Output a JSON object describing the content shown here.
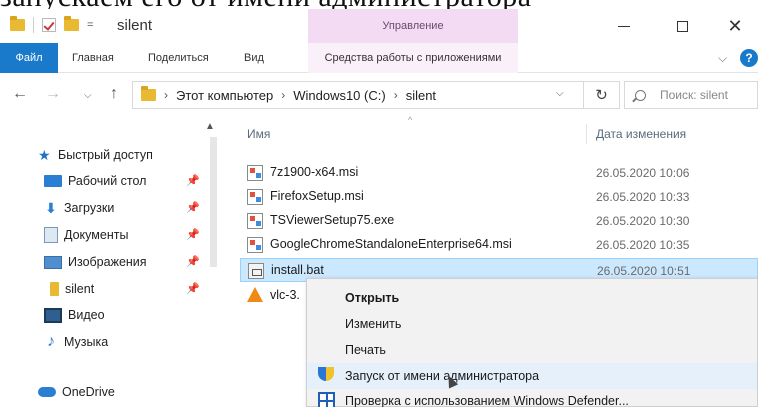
{
  "caption": "запускаем его от имени администратора",
  "window": {
    "title": "silent",
    "manage_tab": "Управление",
    "controls": {
      "close": "✕"
    }
  },
  "qat": {
    "dropdown": "="
  },
  "ribbon": {
    "tabs": [
      "Файл",
      "Главная",
      "Поделиться",
      "Вид",
      "Средства работы с приложениями"
    ],
    "expand": "⌵",
    "help": "?"
  },
  "nav": {
    "back": "←",
    "forward": "→",
    "recent": "⌵",
    "up": "↑",
    "path": [
      "Этот компьютер",
      "Windows10 (C:)",
      "silent"
    ],
    "path_sep": "›",
    "path_dropdown": "⌵",
    "refresh": "↻",
    "search_placeholder": "Поиск: silent"
  },
  "sidebar": {
    "scroll_up": "▲",
    "pin": "📌",
    "quick_access": "Быстрый доступ",
    "items": [
      {
        "label": "Рабочий стол",
        "icon": "desktop-icon",
        "pinned": true
      },
      {
        "label": "Загрузки",
        "icon": "download-icon",
        "pinned": true
      },
      {
        "label": "Документы",
        "icon": "documents-icon",
        "pinned": true
      },
      {
        "label": "Изображения",
        "icon": "images-icon",
        "pinned": true
      },
      {
        "label": "silent",
        "icon": "folder-icon",
        "pinned": true
      },
      {
        "label": "Видео",
        "icon": "video-icon",
        "pinned": false
      },
      {
        "label": "Музыка",
        "icon": "music-icon",
        "pinned": false
      }
    ],
    "onedrive": "OneDrive"
  },
  "columns": {
    "sort_indicator": "^",
    "name": "Имя",
    "date": "Дата изменения"
  },
  "files": [
    {
      "name": "7z1900-x64.msi",
      "date": "26.05.2020 10:06",
      "icon": "msi-icon"
    },
    {
      "name": "FirefoxSetup.msi",
      "date": "26.05.2020 10:33",
      "icon": "msi-icon"
    },
    {
      "name": "TSViewerSetup75.exe",
      "date": "26.05.2020 10:30",
      "icon": "msi-icon"
    },
    {
      "name": "GoogleChromeStandaloneEnterprise64.msi",
      "date": "26.05.2020 10:35",
      "icon": "msi-icon"
    },
    {
      "name": "install.bat",
      "date": "26.05.2020 10:51",
      "icon": "bat-icon",
      "selected": true
    },
    {
      "name": "vlc-3.",
      "date": "",
      "icon": "vlc-icon"
    }
  ],
  "context_menu": {
    "items": [
      {
        "label": "Открыть",
        "bold": true
      },
      {
        "label": "Изменить"
      },
      {
        "label": "Печать"
      },
      {
        "label": "Запуск от имени администратора",
        "icon": "shield-icon",
        "hover": true
      },
      {
        "label": "Проверка с использованием Windows Defender...",
        "icon": "defender-icon"
      }
    ]
  }
}
